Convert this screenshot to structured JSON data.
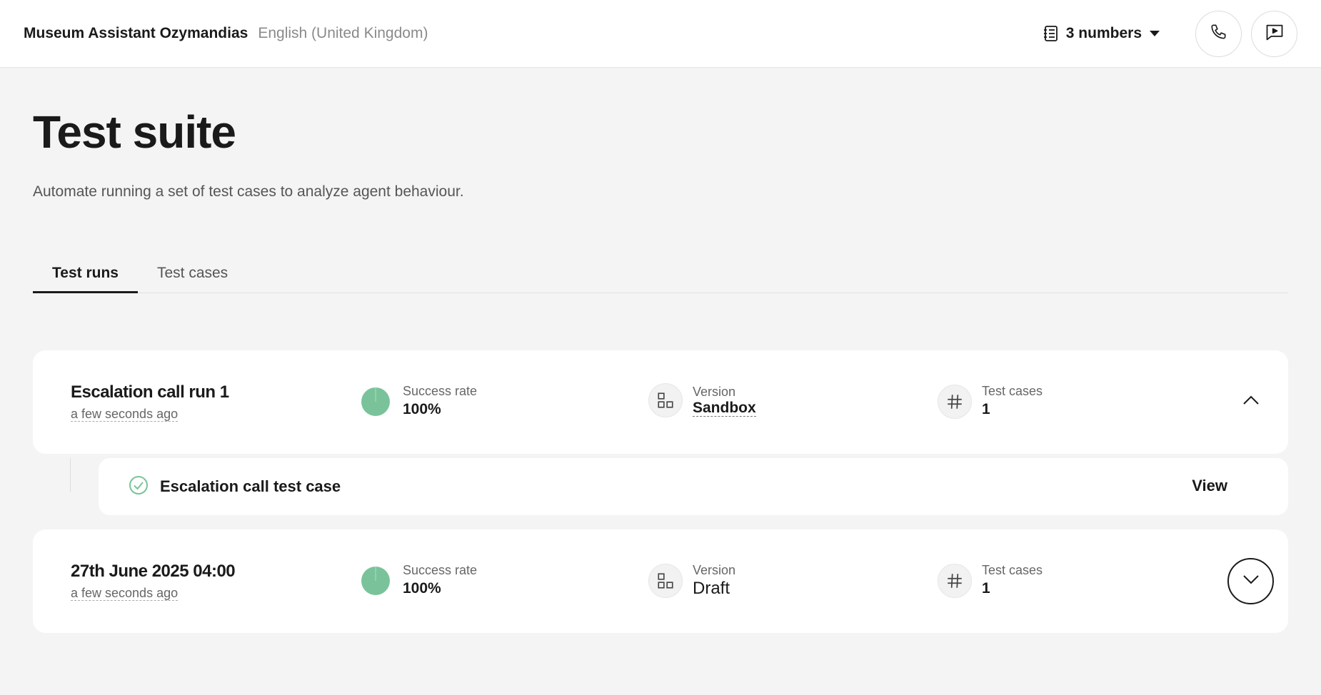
{
  "header": {
    "agent_name": "Museum Assistant Ozymandias",
    "language": "English (United Kingdom)",
    "numbers_label": "3 numbers"
  },
  "page": {
    "title": "Test suite",
    "subtitle": "Automate running a set of test cases to analyze agent behaviour."
  },
  "tabs": [
    {
      "label": "Test runs",
      "active": true
    },
    {
      "label": "Test cases",
      "active": false
    }
  ],
  "runs": [
    {
      "title": "Escalation call run 1",
      "time": "a few seconds ago",
      "success_label": "Success rate",
      "success_value": "100%",
      "version_label": "Version",
      "version_value": "Sandbox",
      "cases_label": "Test cases",
      "cases_value": "1",
      "expanded": true,
      "test_cases": [
        {
          "name": "Escalation call test case",
          "action": "View",
          "status": "passed"
        }
      ]
    },
    {
      "title": "27th June 2025 04:00",
      "time": "a few seconds ago",
      "success_label": "Success rate",
      "success_value": "100%",
      "version_label": "Version",
      "version_value": "Draft",
      "cases_label": "Test cases",
      "cases_value": "1",
      "expanded": false
    }
  ],
  "colors": {
    "success": "#7ac39a",
    "background": "#f4f4f4",
    "card": "#ffffff",
    "text": "#1a1a1a"
  }
}
